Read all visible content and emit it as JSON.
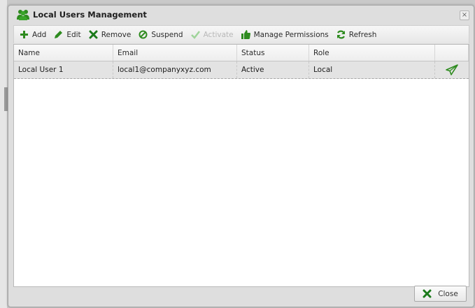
{
  "window": {
    "title": "Local Users Management",
    "close_glyph": "×"
  },
  "toolbar": {
    "add_label": "Add",
    "edit_label": "Edit",
    "remove_label": "Remove",
    "suspend_label": "Suspend",
    "activate_label": "Activate",
    "manage_permissions_label": "Manage Permissions",
    "refresh_label": "Refresh"
  },
  "grid": {
    "columns": [
      "Name",
      "Email",
      "Status",
      "Role"
    ],
    "rows": [
      {
        "name": "Local User 1",
        "email": "local1@companyxyz.com",
        "status": "Active",
        "role": "Local",
        "action_icon": "send-icon"
      }
    ]
  },
  "footer": {
    "close_label": "Close"
  },
  "colors": {
    "accent_green": "#2e8b1f",
    "row_selected": "#e3e3e3",
    "disabled_text": "#b8b8b8",
    "remove_red": "#1a7a1a"
  }
}
